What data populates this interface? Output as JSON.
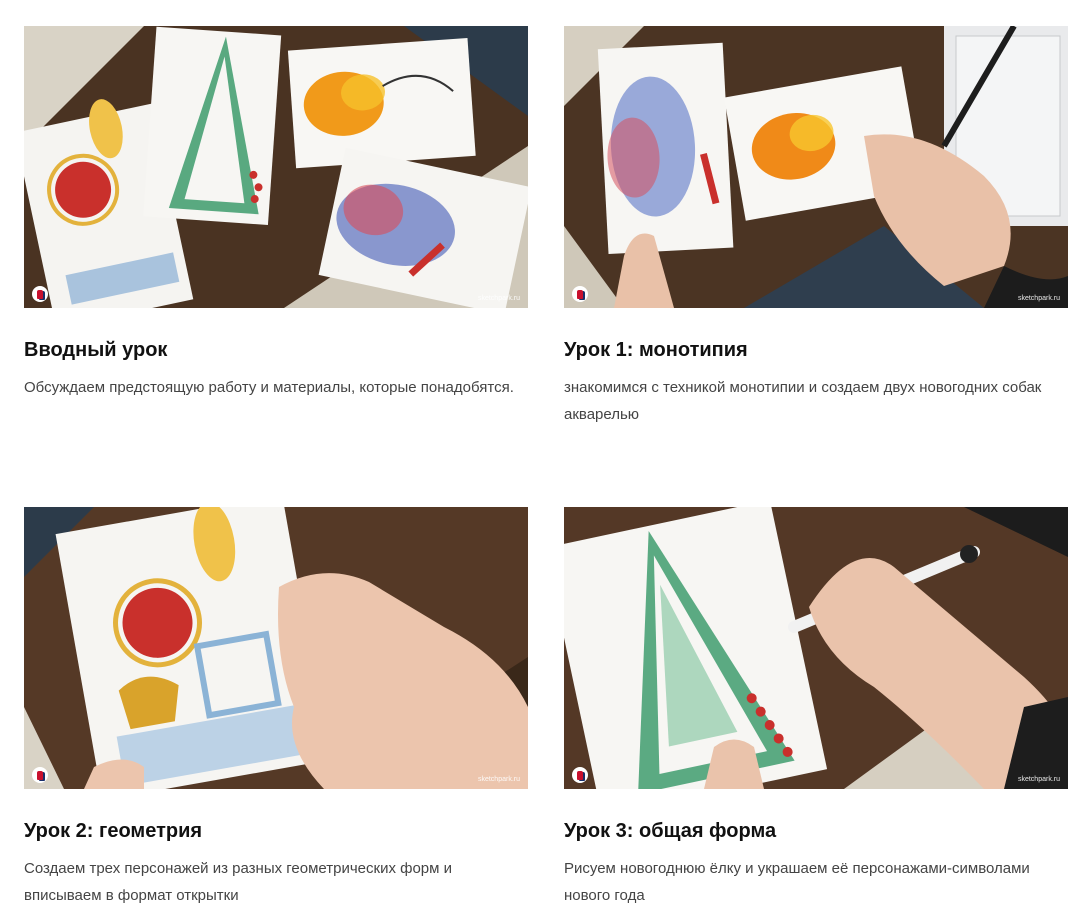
{
  "lessons": [
    {
      "title": "Вводный урок",
      "description": "Обсуждаем предстоящую работу и материалы, которые понадобятся.",
      "thumbnail_watermark": "sketchpark.ru",
      "thumbnail_icon": "sketchpark-logo-icon"
    },
    {
      "title": "Урок 1: монотипия",
      "description": "знакомимся с техникой монотипии и создаем двух новогодних собак акварелью",
      "thumbnail_watermark": "sketchpark.ru",
      "thumbnail_icon": "sketchpark-logo-icon"
    },
    {
      "title": "Урок 2: геометрия",
      "description": "Создаем трех персонажей из разных геометрических форм и вписываем в формат открытки",
      "thumbnail_watermark": "sketchpark.ru",
      "thumbnail_icon": "sketchpark-logo-icon"
    },
    {
      "title": "Урок 3: общая форма",
      "description": "Рисуем новогоднюю ёлку и украшаем её персонажами-символами нового года",
      "thumbnail_watermark": "sketchpark.ru",
      "thumbnail_icon": "sketchpark-logo-icon"
    }
  ],
  "colors": {
    "title": "#111111",
    "description": "#444444",
    "wood_dark": "#3d2a1c",
    "wood_light": "#d8d2c4"
  }
}
